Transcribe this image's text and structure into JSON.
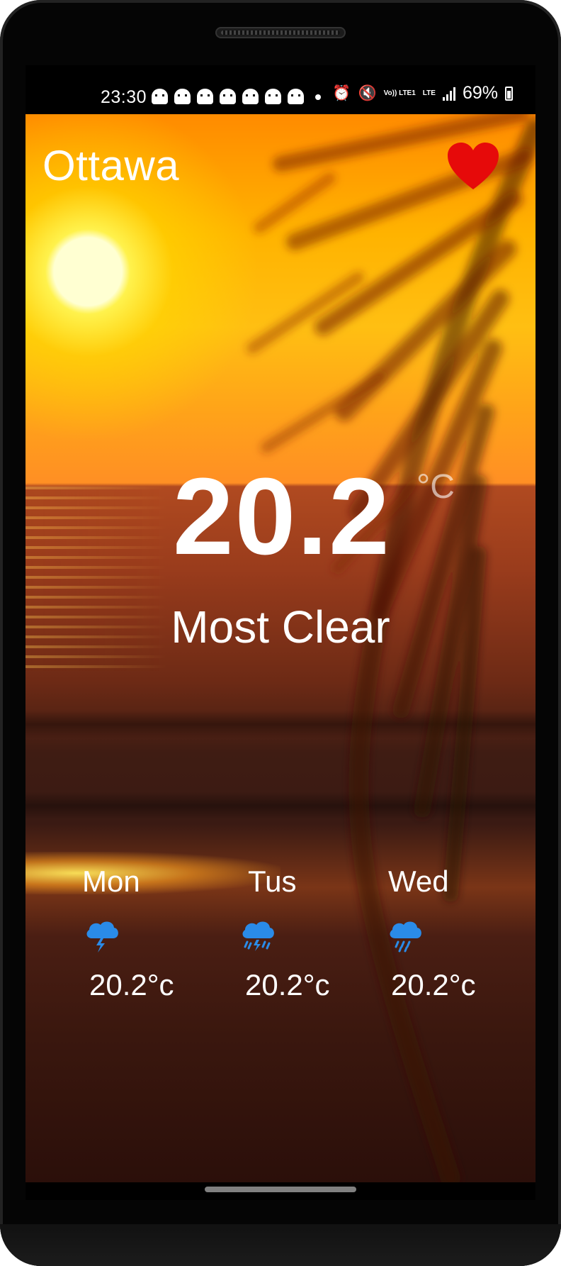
{
  "status_bar": {
    "time": "23:30",
    "notification_icons": [
      "snapchat-icon",
      "snapchat-icon",
      "snapchat-icon",
      "snapchat-icon",
      "snapchat-icon",
      "snapchat-icon",
      "snapchat-icon"
    ],
    "volte_label": "Vo)) LTE1",
    "lte_label": "LTE",
    "battery_percent": "69%"
  },
  "header": {
    "city": "Ottawa",
    "favorite_icon": "heart-icon",
    "favorite_color": "#e60a0a"
  },
  "current": {
    "temperature": "20.2",
    "unit": "°C",
    "condition": "Most Clear"
  },
  "forecast": [
    {
      "day": "Mon",
      "icon": "thunderstorm-icon",
      "temp": "20.2°c"
    },
    {
      "day": "Tus",
      "icon": "thunder-rain-icon",
      "temp": "20.2°c"
    },
    {
      "day": "Wed",
      "icon": "rain-icon",
      "temp": "20.2°c"
    }
  ],
  "colors": {
    "icon_blue": "#2a8be8"
  }
}
